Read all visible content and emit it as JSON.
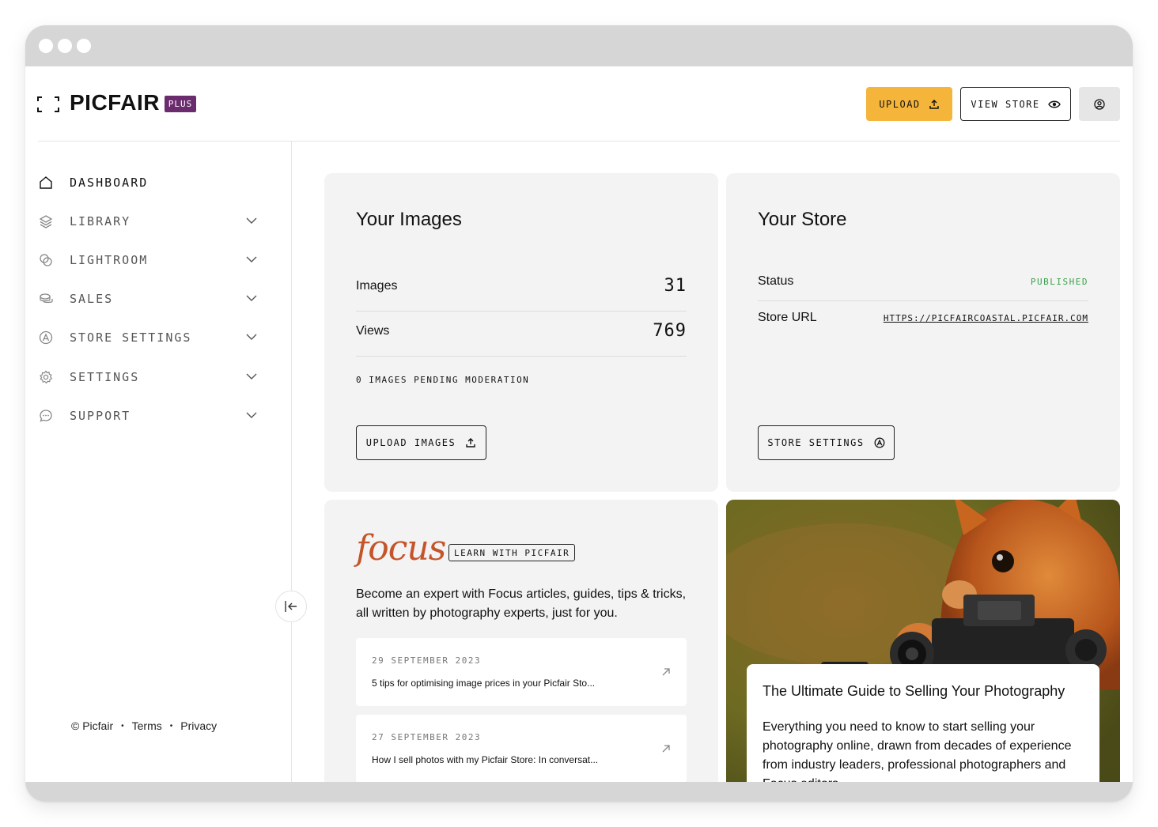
{
  "brand": {
    "name": "PICFAIR",
    "badge": "PLUS"
  },
  "header": {
    "upload_label": "UPLOAD",
    "view_store_label": "VIEW STORE"
  },
  "sidebar": {
    "items": [
      {
        "label": "DASHBOARD",
        "icon": "home-icon",
        "active": true
      },
      {
        "label": "LIBRARY",
        "icon": "layers-icon"
      },
      {
        "label": "LIGHTROOM",
        "icon": "lightroom-icon"
      },
      {
        "label": "SALES",
        "icon": "coins-icon"
      },
      {
        "label": "STORE SETTINGS",
        "icon": "store-settings-icon"
      },
      {
        "label": "SETTINGS",
        "icon": "gear-icon"
      },
      {
        "label": "SUPPORT",
        "icon": "chat-icon"
      }
    ],
    "footer": {
      "copyright": "© Picfair",
      "sep": "•",
      "terms": "Terms",
      "privacy": "Privacy"
    }
  },
  "images_card": {
    "title": "Your Images",
    "rows": [
      {
        "label": "Images",
        "value": "31"
      },
      {
        "label": "Views",
        "value": "769"
      }
    ],
    "pending": "0 IMAGES PENDING MODERATION",
    "button": "UPLOAD IMAGES"
  },
  "store_card": {
    "title": "Your Store",
    "status_label": "Status",
    "status_value": "PUBLISHED",
    "url_label": "Store URL",
    "url_value": "HTTPS://PICFAIRCOASTAL.PICFAIR.COM",
    "button": "STORE SETTINGS"
  },
  "focus_card": {
    "brand": "focus",
    "badge": "LEARN WITH PICFAIR",
    "description": "Become an expert with Focus articles, guides, tips & tricks, all written by photography experts, just for you.",
    "articles": [
      {
        "date": "29 SEPTEMBER 2023",
        "title": "5 tips for optimising image prices in your Picfair Sto..."
      },
      {
        "date": "27 SEPTEMBER 2023",
        "title": "How I sell photos with my Picfair Store: In conversat..."
      }
    ]
  },
  "guide_card": {
    "title": "The Ultimate Guide to Selling Your Photography",
    "description": "Everything you need to know to start selling your photography online, drawn from decades of experience from industry leaders, professional photographers and Focus editors."
  },
  "colors": {
    "accent": "#f5b53b",
    "plus_badge": "#6b2c6e",
    "focus": "#c4552b",
    "published": "#3aa14a"
  }
}
